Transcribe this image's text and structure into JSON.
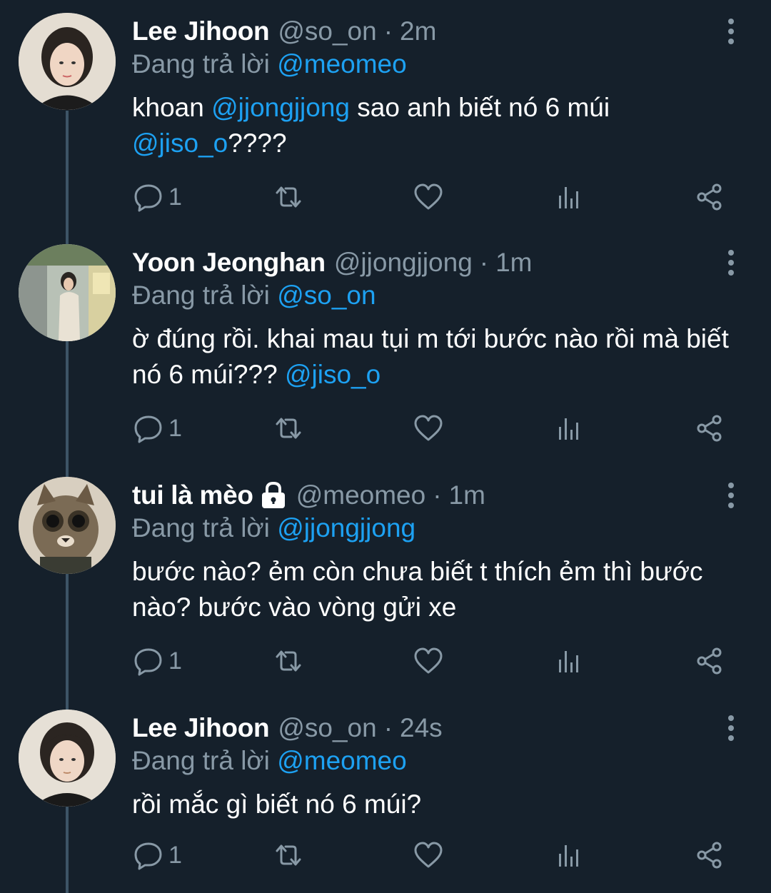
{
  "tweets": [
    {
      "name": "Lee Jihoon",
      "handle": "@so_on",
      "sep": "·",
      "time": "2m",
      "reply_prefix": "Đang trả lời",
      "reply_to": "@meomeo",
      "body_parts": [
        {
          "text": "khoan ",
          "mention": false
        },
        {
          "text": "@jjongjjong",
          "mention": true
        },
        {
          "text": " sao anh biết nó 6 múi ",
          "mention": false
        },
        {
          "text": "@jiso_o",
          "mention": true
        },
        {
          "text": "????",
          "mention": false
        }
      ],
      "reply_count": "1"
    },
    {
      "name": "Yoon Jeonghan",
      "handle": "@jjongjjong",
      "sep": "·",
      "time": "1m",
      "reply_prefix": "Đang trả lời",
      "reply_to": "@so_on",
      "body_parts": [
        {
          "text": "ờ đúng rồi. khai mau tụi m tới bước nào rồi mà biết nó 6 múi??? ",
          "mention": false
        },
        {
          "text": "@jiso_o",
          "mention": true
        }
      ],
      "reply_count": "1"
    },
    {
      "name": "tui là mèo",
      "handle": "@meomeo",
      "sep": "·",
      "time": "1m",
      "reply_prefix": "Đang trả lời",
      "reply_to": "@jjongjjong",
      "body_parts": [
        {
          "text": "bước nào? ẻm còn chưa biết t thích ẻm thì bước nào? bước vào vòng gửi xe",
          "mention": false
        }
      ],
      "reply_count": "1"
    },
    {
      "name": "Lee Jihoon",
      "handle": "@so_on",
      "sep": "·",
      "time": "24s",
      "reply_prefix": "Đang trả lời",
      "reply_to": "@meomeo",
      "body_parts": [
        {
          "text": "rồi mắc gì biết nó 6 múi?",
          "mention": false
        }
      ],
      "reply_count": "1"
    }
  ],
  "icons": {
    "reply": "reply-icon",
    "retweet": "retweet-icon",
    "like": "heart-icon",
    "analytics": "analytics-icon",
    "share": "share-icon",
    "more": "more-vertical-icon",
    "lock": "lock-icon"
  },
  "colors": {
    "background": "#15202b",
    "mention": "#1da1f2",
    "muted": "#8899a6",
    "thread_line": "#3d5466"
  }
}
